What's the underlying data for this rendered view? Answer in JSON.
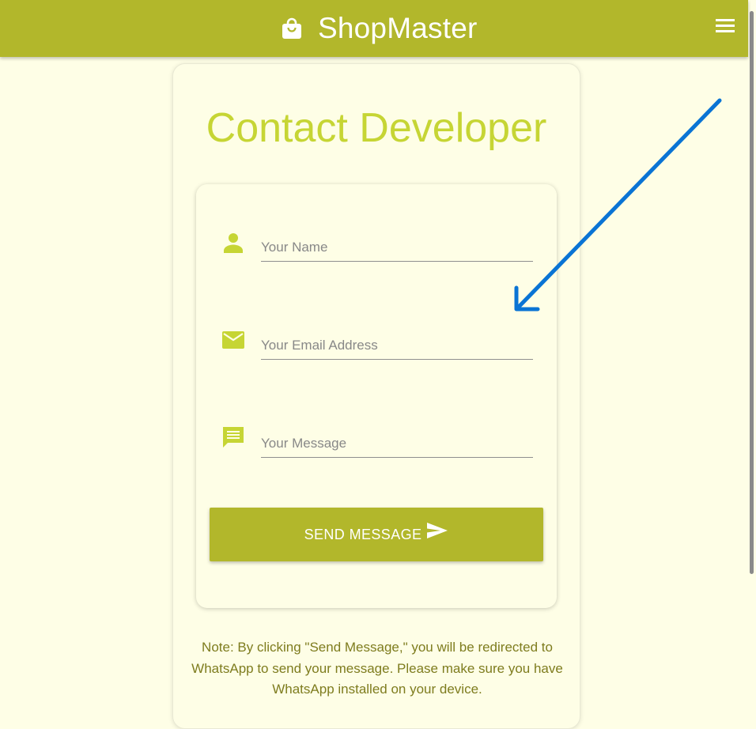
{
  "header": {
    "brand_name": "ShopMaster",
    "brand_icon": "shopping-bag-icon",
    "menu_icon": "hamburger-menu-icon"
  },
  "contact": {
    "title": "Contact Developer",
    "fields": {
      "name": {
        "placeholder": "Your Name",
        "value": "",
        "icon": "person-icon"
      },
      "email": {
        "placeholder": "Your Email Address",
        "value": "",
        "icon": "email-icon"
      },
      "message": {
        "placeholder": "Your Message",
        "value": "",
        "icon": "message-icon"
      }
    },
    "send_button": {
      "label": "SEND MESSAGE",
      "icon": "send-icon"
    },
    "note": "Note: By clicking \"Send Message,\" you will be redirected to WhatsApp to send your message. Please make sure you have WhatsApp installed on your device."
  },
  "annotation": {
    "icon": "annotation-arrow"
  },
  "colors": {
    "header_bg": "#b2b72b",
    "page_bg": "#fefee6",
    "accent": "#c6d534",
    "note_text": "#7e7c1e",
    "annotation_arrow": "#0a74d4"
  }
}
